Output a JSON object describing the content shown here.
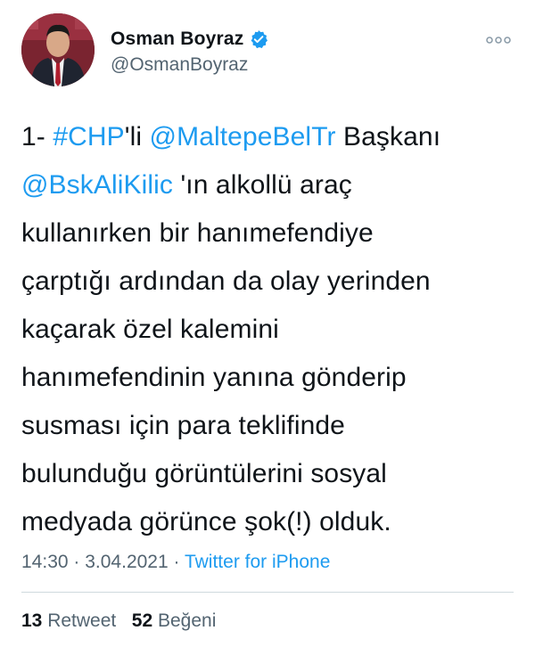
{
  "author": {
    "display_name": "Osman Boyraz",
    "handle": "@OsmanBoyraz",
    "verified": true,
    "avatar_icon": "profile-photo"
  },
  "tweet": {
    "segments": [
      {
        "text": "1- ",
        "type": "text"
      },
      {
        "text": "#CHP",
        "type": "link"
      },
      {
        "text": "'li ",
        "type": "text"
      },
      {
        "text": "@MaltepeBelTr",
        "type": "link"
      },
      {
        "text": " Başkanı\n",
        "type": "text"
      },
      {
        "text": "@BskAliKilic",
        "type": "link"
      },
      {
        "text": " 'ın alkollü araç\nkullanırken bir hanımefendiye\nçarptığı ardından da olay yerinden\nkaçarak özel kalemini\nhanımefendinin yanına gönderip\nsusması için para teklifinde\nbulunduğu görüntülerini sosyal\nmedyada görünce şok(!) olduk.",
        "type": "text"
      }
    ]
  },
  "meta": {
    "time": "14:30",
    "separator": " · ",
    "date": "3.04.2021",
    "source": "Twitter for iPhone"
  },
  "stats": {
    "retweets": "13",
    "retweets_label": "Retweet",
    "likes": "52",
    "likes_label": "Beğeni"
  },
  "colors": {
    "link": "#1d9bf0",
    "secondary": "#536471",
    "text": "#0f1419",
    "divider": "#cfd9de"
  }
}
